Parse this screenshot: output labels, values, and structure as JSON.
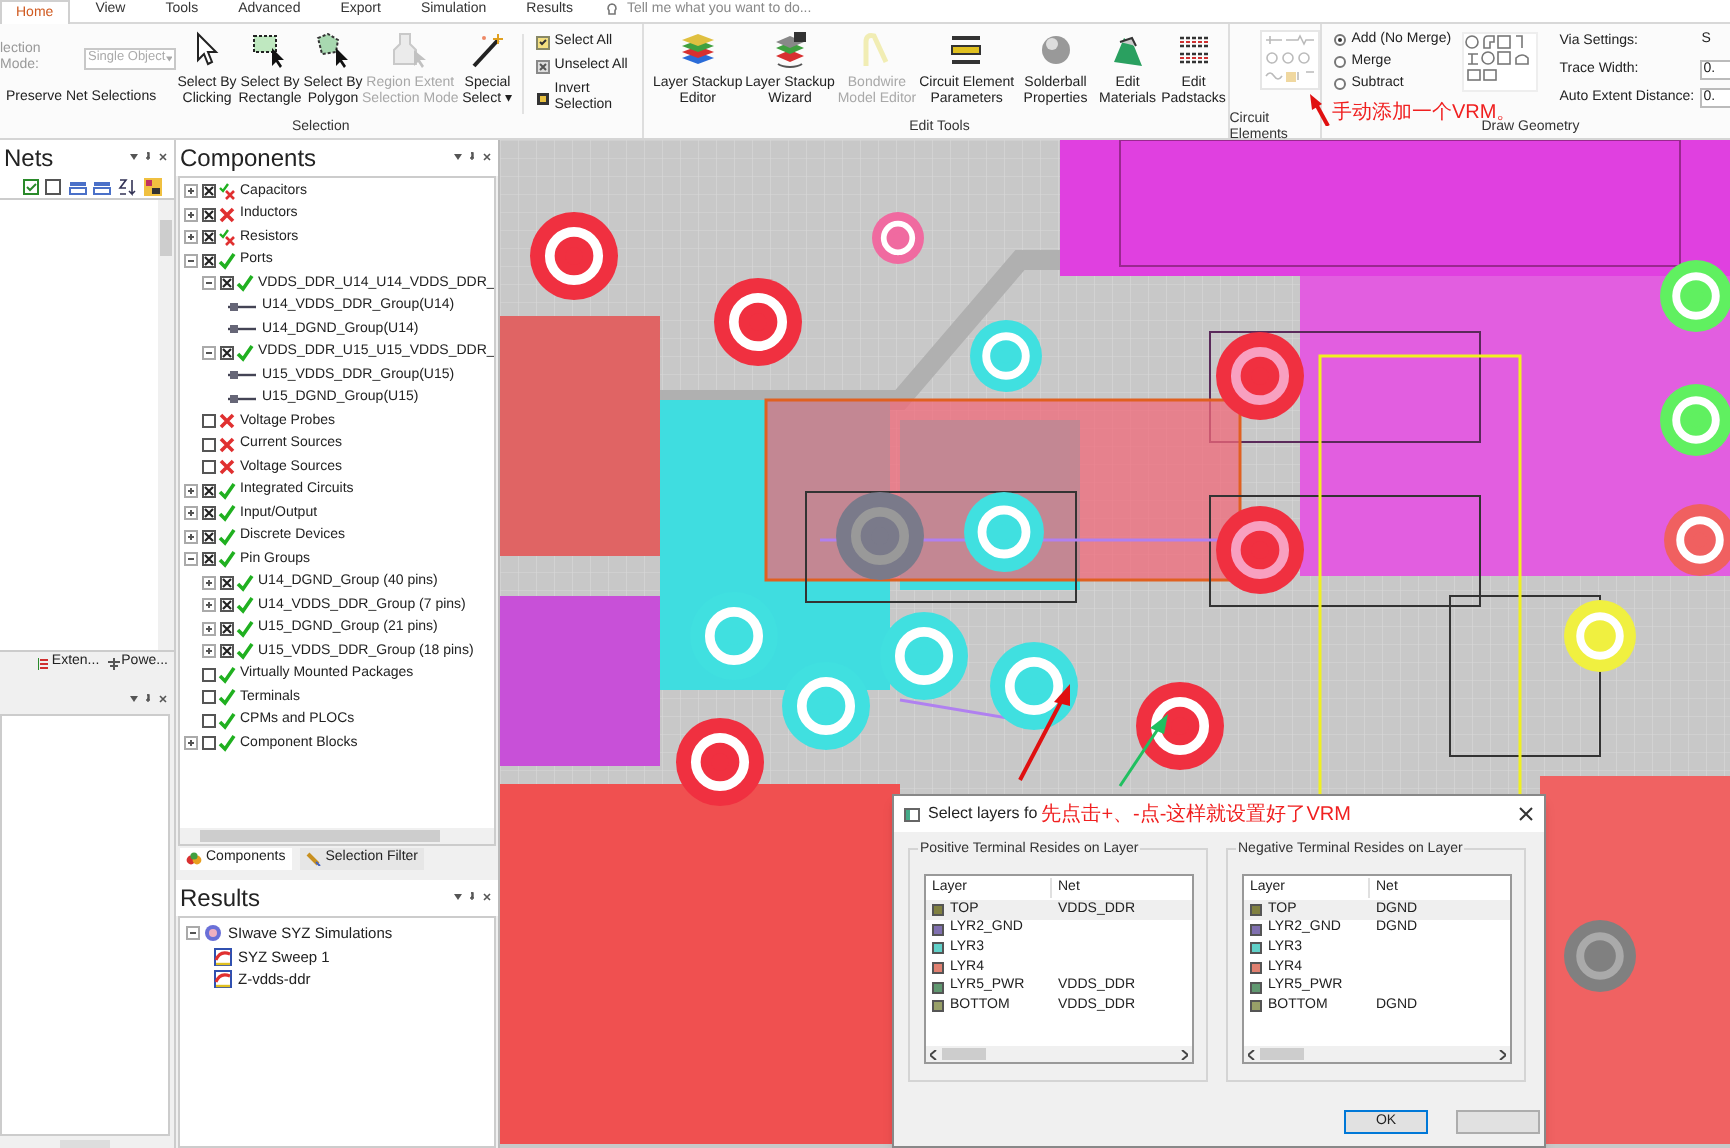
{
  "ribbon_tabs": [
    {
      "label": "Home",
      "selected": true
    },
    {
      "label": "View",
      "selected": false
    },
    {
      "label": "Tools",
      "selected": false
    },
    {
      "label": "Advanced",
      "selected": false
    },
    {
      "label": "Export",
      "selected": false
    },
    {
      "label": "Simulation",
      "selected": false
    },
    {
      "label": "Results",
      "selected": false
    }
  ],
  "tell_me": {
    "placeholder": "Tell me what you want to do..."
  },
  "selection_group": {
    "mode_label": "lection Mode:",
    "mode_value": "Single Object",
    "preserve": "Preserve Net Selections",
    "label": "Selection",
    "buttons": [
      {
        "label": "Select By\nClicking",
        "disabled": false
      },
      {
        "label": "Select By\nRectangle",
        "disabled": false
      },
      {
        "label": "Select By\nPolygon",
        "disabled": false
      },
      {
        "label": "Region Extent\nSelection Mode",
        "disabled": true
      },
      {
        "label": "Special\nSelect ▾",
        "disabled": false
      }
    ],
    "small_buttons": [
      "Select All",
      "Unselect All",
      "Invert Selection"
    ]
  },
  "edit_tools_group": {
    "label": "Edit Tools",
    "buttons": [
      {
        "label": "Layer Stackup\nEditor",
        "disabled": false
      },
      {
        "label": "Layer Stackup\nWizard",
        "disabled": false
      },
      {
        "label": "Bondwire\nModel Editor",
        "disabled": true
      },
      {
        "label": "Circuit Element\nParameters",
        "disabled": false
      },
      {
        "label": "Solderball\nProperties",
        "disabled": false
      },
      {
        "label": "Edit\nMaterials",
        "disabled": false
      },
      {
        "label": "Edit\nPadstacks",
        "disabled": false
      }
    ]
  },
  "circuit_elements_group": {
    "label": "Circuit Elements"
  },
  "draw_geometry_group": {
    "label": "Draw Geometry",
    "modes": [
      {
        "label": "Add (No Merge)",
        "selected": true
      },
      {
        "label": "Merge",
        "selected": false
      },
      {
        "label": "Subtract",
        "selected": false
      }
    ],
    "settings": [
      {
        "label": "Via Settings:",
        "value": "S"
      },
      {
        "label": "Trace Width:",
        "value": "0."
      },
      {
        "label": "Auto Extent Distance:",
        "value": "0."
      }
    ]
  },
  "annotations": [
    {
      "text": "手动添加一个VRM。"
    },
    {
      "text": "先点击+、-点-这样就设置好了VRM"
    }
  ],
  "nets_panel": {
    "title": "Nets",
    "tabs": [
      {
        "label": "Exten...",
        "selected": false
      },
      {
        "label": "Powe...",
        "selected": false
      }
    ]
  },
  "components_panel": {
    "title": "Components",
    "tree": [
      {
        "label": "Capacitors",
        "expanded": false,
        "checked": true,
        "valid": false,
        "mixed": true
      },
      {
        "label": "Inductors",
        "expanded": false,
        "checked": true,
        "valid": false
      },
      {
        "label": "Resistors",
        "expanded": false,
        "checked": true,
        "valid": false,
        "mixed": true
      },
      {
        "label": "Ports",
        "expanded": true,
        "checked": true,
        "valid": true,
        "children": [
          {
            "label": "VDDS_DDR_U14_U14_VDDS_DDR_",
            "expanded": true,
            "checked": true,
            "valid": true,
            "children": [
              {
                "label": "U14_VDDS_DDR_Group(U14)",
                "kind": "terminal"
              },
              {
                "label": "U14_DGND_Group(U14)",
                "kind": "terminal"
              }
            ]
          },
          {
            "label": "VDDS_DDR_U15_U15_VDDS_DDR_",
            "expanded": true,
            "checked": true,
            "valid": true,
            "children": [
              {
                "label": "U15_VDDS_DDR_Group(U15)",
                "kind": "terminal"
              },
              {
                "label": "U15_DGND_Group(U15)",
                "kind": "terminal"
              }
            ]
          }
        ]
      },
      {
        "label": "Voltage Probes",
        "checked": false,
        "valid": false
      },
      {
        "label": "Current Sources",
        "checked": false,
        "valid": false
      },
      {
        "label": "Voltage Sources",
        "checked": false,
        "valid": false
      },
      {
        "label": "Integrated Circuits",
        "expanded": false,
        "checked": true,
        "valid": true
      },
      {
        "label": "Input/Output",
        "expanded": false,
        "checked": true,
        "valid": true
      },
      {
        "label": "Discrete Devices",
        "expanded": false,
        "checked": true,
        "valid": true
      },
      {
        "label": "Pin Groups",
        "expanded": true,
        "checked": true,
        "valid": true,
        "children": [
          {
            "label": "U14_DGND_Group (40 pins)",
            "expanded": false,
            "checked": true,
            "valid": true
          },
          {
            "label": "U14_VDDS_DDR_Group (7 pins)",
            "expanded": false,
            "checked": true,
            "valid": true
          },
          {
            "label": "U15_DGND_Group (21 pins)",
            "expanded": false,
            "checked": true,
            "valid": true
          },
          {
            "label": "U15_VDDS_DDR_Group (18 pins)",
            "expanded": false,
            "checked": true,
            "valid": true
          }
        ]
      },
      {
        "label": "Virtually Mounted Packages",
        "checked": false,
        "valid": true
      },
      {
        "label": "Terminals",
        "checked": false,
        "valid": true
      },
      {
        "label": "CPMs and PLOCs",
        "checked": false,
        "valid": true
      },
      {
        "label": "Component Blocks",
        "expanded": false,
        "checked": false,
        "valid": true
      }
    ],
    "tabs": [
      {
        "label": "Components",
        "selected": true
      },
      {
        "label": "Selection Filter",
        "selected": false
      }
    ]
  },
  "results_panel": {
    "title": "Results",
    "tree": [
      {
        "label": "SIwave SYZ Simulations",
        "expanded": true,
        "children": [
          {
            "label": "SYZ Sweep 1"
          },
          {
            "label": "Z-vdds-ddr"
          }
        ]
      }
    ]
  },
  "dialog": {
    "title": "Select layers fo",
    "buttons": [
      "OK"
    ],
    "panels": [
      {
        "title": "Positive Terminal Resides on Layer",
        "columns": [
          "Layer",
          "Net"
        ],
        "rows": [
          {
            "layer": "TOP",
            "net": "VDDS_DDR",
            "color": "#808040",
            "selected": true
          },
          {
            "layer": "LYR2_GND",
            "color": "#8070b0",
            "selected": false
          },
          {
            "layer": "LYR3",
            "color": "#60d0c8",
            "selected": false
          },
          {
            "layer": "LYR4",
            "color": "#e08070",
            "selected": false
          },
          {
            "layer": "LYR5_PWR",
            "net": "VDDS_DDR",
            "color": "#609870",
            "selected": false
          },
          {
            "layer": "BOTTOM",
            "net": "VDDS_DDR",
            "color": "#98a068",
            "selected": false
          }
        ]
      },
      {
        "title": "Negative Terminal Resides on Layer",
        "columns": [
          "Layer",
          "Net"
        ],
        "rows": [
          {
            "layer": "TOP",
            "net": "DGND",
            "color": "#808040",
            "selected": true
          },
          {
            "layer": "LYR2_GND",
            "net": "DGND",
            "color": "#8070b0",
            "selected": false
          },
          {
            "layer": "LYR3",
            "color": "#60d0c8",
            "selected": false
          },
          {
            "layer": "LYR4",
            "color": "#e08070",
            "selected": false
          },
          {
            "layer": "LYR5_PWR",
            "color": "#609870",
            "selected": false
          },
          {
            "layer": "BOTTOM",
            "net": "DGND",
            "color": "#98a068",
            "selected": false
          }
        ]
      }
    ]
  }
}
